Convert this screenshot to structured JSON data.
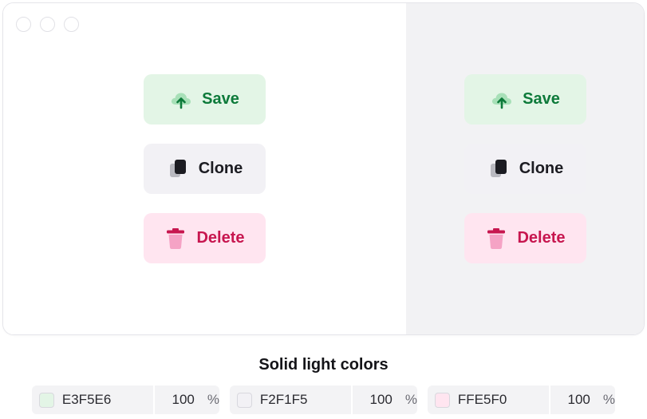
{
  "buttons": {
    "save_label": "Save",
    "clone_label": "Clone",
    "delete_label": "Delete"
  },
  "icons": {
    "save": "cloud-upload-icon",
    "clone": "copy-icon",
    "delete": "trash-icon"
  },
  "caption": "Solid light colors",
  "swatches": [
    {
      "hex": "E3F5E6",
      "opacity": "100",
      "unit": "%",
      "color": "#E3F5E6"
    },
    {
      "hex": "F2F1F5",
      "opacity": "100",
      "unit": "%",
      "color": "#F2F1F5"
    },
    {
      "hex": "FFE5F0",
      "opacity": "100",
      "unit": "%",
      "color": "#FFE5F0"
    }
  ],
  "colors": {
    "save_text": "#0D7A3A",
    "clone_text": "#1C1C22",
    "delete_text": "#C7164F",
    "right_pane_bg": "#F2F2F4"
  }
}
